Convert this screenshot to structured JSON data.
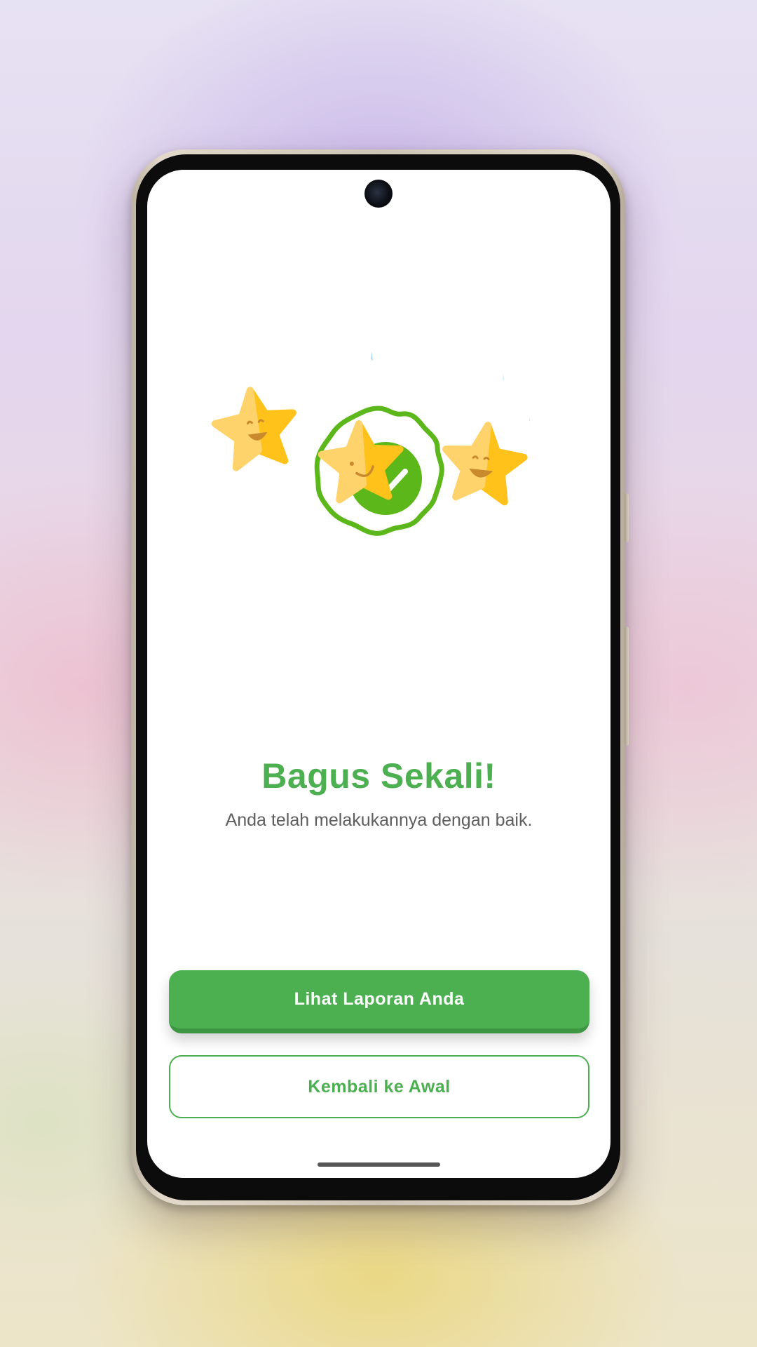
{
  "result": {
    "title": "Bagus Sekali!",
    "subtitle": "Anda telah melakukannya dengan baik."
  },
  "actions": {
    "view_report_label": "Lihat Laporan Anda",
    "back_to_start_label": "Kembali ke Awal"
  },
  "colors": {
    "accent": "#4caf50",
    "badge_green": "#5cb81a",
    "star_light": "#ffd36b",
    "star_dark": "#ffc21a",
    "background_top": "#e3d6ee",
    "background_bottom": "#ede5c8"
  },
  "illustration": {
    "icons": [
      "star-left-icon",
      "badge-check-icon",
      "star-center-icon",
      "star-right-icon"
    ]
  }
}
